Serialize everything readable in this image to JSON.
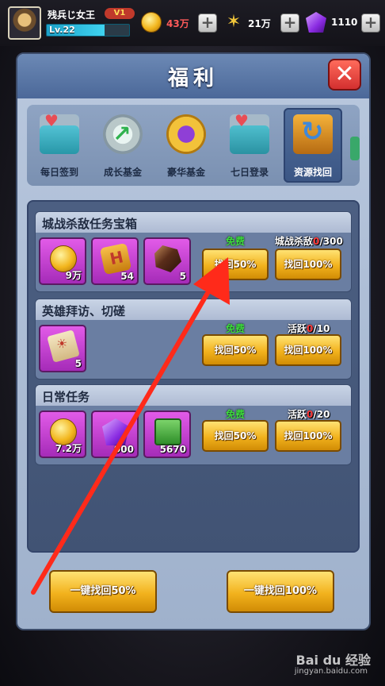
{
  "player": {
    "name": "残兵じ女王",
    "vip": "1",
    "level": "Lv.22"
  },
  "resources": {
    "coins": "43万",
    "food": "21万",
    "gems": "1110"
  },
  "panel": {
    "title": "福利",
    "tabs": [
      {
        "label": "每日签到",
        "icon": "calendar-gift-icon"
      },
      {
        "label": "成长基金",
        "icon": "growth-coin-icon"
      },
      {
        "label": "豪华基金",
        "icon": "luxury-coin-icon"
      },
      {
        "label": "七日登录",
        "icon": "login-calendar-icon"
      },
      {
        "label": "资源找回",
        "icon": "resource-recover-icon",
        "active": true
      }
    ],
    "tasks": [
      {
        "title": "城战杀敌任务宝箱",
        "items": [
          {
            "icon": "coin-icon",
            "count": "9万"
          },
          {
            "icon": "hammer-token-icon",
            "count": "54"
          },
          {
            "icon": "ore-icon",
            "count": "5"
          }
        ],
        "free_label": "免费",
        "progress_label": "城战杀敌",
        "progress_current": "0",
        "progress_total": "/300",
        "btn_half": "找回50%",
        "btn_full": "找回100%"
      },
      {
        "title": "英雄拜访、切磋",
        "items": [
          {
            "icon": "scroll-icon",
            "count": "5"
          }
        ],
        "free_label": "免费",
        "progress_label": "活跃",
        "progress_current": "0",
        "progress_total": "/10",
        "btn_half": "找回50%",
        "btn_full": "找回100%"
      },
      {
        "title": "日常任务",
        "items": [
          {
            "icon": "coin-icon",
            "count": "7.2万"
          },
          {
            "icon": "gem-icon",
            "count": "900"
          },
          {
            "icon": "book-icon",
            "count": "5670"
          }
        ],
        "free_label": "免费",
        "progress_label": "活跃",
        "progress_current": "0",
        "progress_total": "/20",
        "btn_half": "找回50%",
        "btn_full": "找回100%"
      }
    ],
    "bulk_half": "一键找回50%",
    "bulk_full": "一键找回100%"
  },
  "watermark": {
    "brand": "Bai du 经验",
    "url": "jingyan.baidu.com"
  },
  "colors": {
    "button_gold": "#f2b21d",
    "item_purple": "#c146d6",
    "free_green": "#3ddc3d",
    "progress_red": "#ff3b3b",
    "annotation_arrow": "#ff2a1a"
  }
}
